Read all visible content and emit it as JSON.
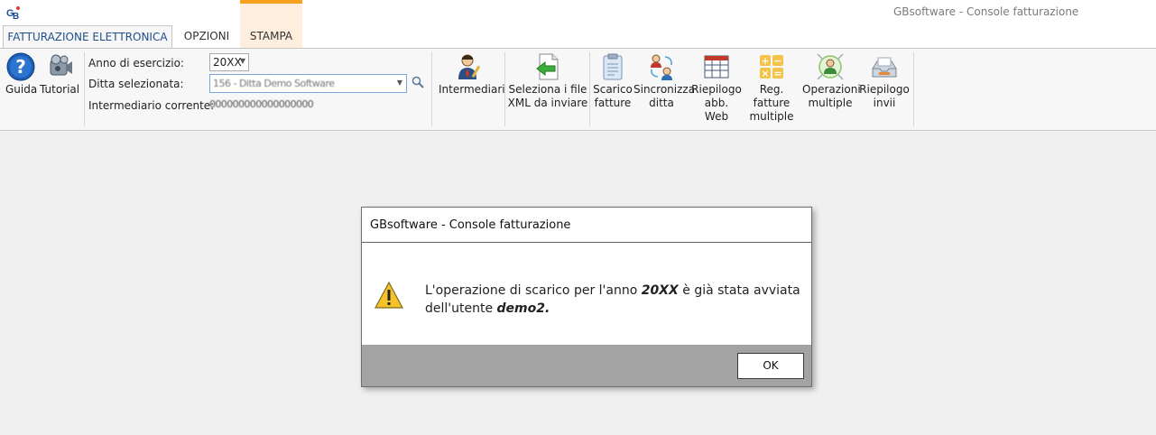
{
  "window": {
    "title": "GBsoftware - Console fatturazione",
    "logo_text": "GB"
  },
  "tabs": [
    {
      "label": "FATTURAZIONE ELETTRONICA",
      "active": true
    },
    {
      "label": "OPZIONI",
      "active": false
    },
    {
      "label": "STAMPA",
      "active": false
    }
  ],
  "ribbon": {
    "help": {
      "guida": "Guida",
      "tutorial": "Tutorial"
    },
    "form": {
      "anno_label": "Anno di esercizio:",
      "anno_value": "20XX",
      "ditta_label": "Ditta selezionata:",
      "ditta_value": "156 - Ditta Demo Software",
      "intermediario_label": "Intermediario corrente:",
      "intermediario_value": "000000000000000000"
    },
    "buttons": {
      "intermediari": "Intermediari",
      "seleziona_1": "Seleziona i file",
      "seleziona_2": "XML da inviare",
      "scarico_1": "Scarico",
      "scarico_2": "fatture",
      "sincronizza_1": "Sincronizza",
      "sincronizza_2": "ditta",
      "riepilogo_abb_1": "Riepilogo",
      "riepilogo_abb_2": "abb. Web",
      "reg_1": "Reg. fatture",
      "reg_2": "multiple",
      "operazioni_1": "Operazioni",
      "operazioni_2": "multiple",
      "riepilogo_inv_1": "Riepilogo",
      "riepilogo_inv_2": "invii"
    }
  },
  "dialog": {
    "title": "GBsoftware - Console fatturazione",
    "msg_part1": "L'operazione di scarico per l'anno ",
    "msg_year": "20XX",
    "msg_part2": " è già stata avviata",
    "msg_part3": "dell'utente ",
    "msg_user": "demo2.",
    "ok_label": "OK"
  },
  "colors": {
    "accent_tab": "#1f4e8c",
    "stampa_highlight": "#f7a01e",
    "dialog_footer": "#a3a3a3"
  }
}
